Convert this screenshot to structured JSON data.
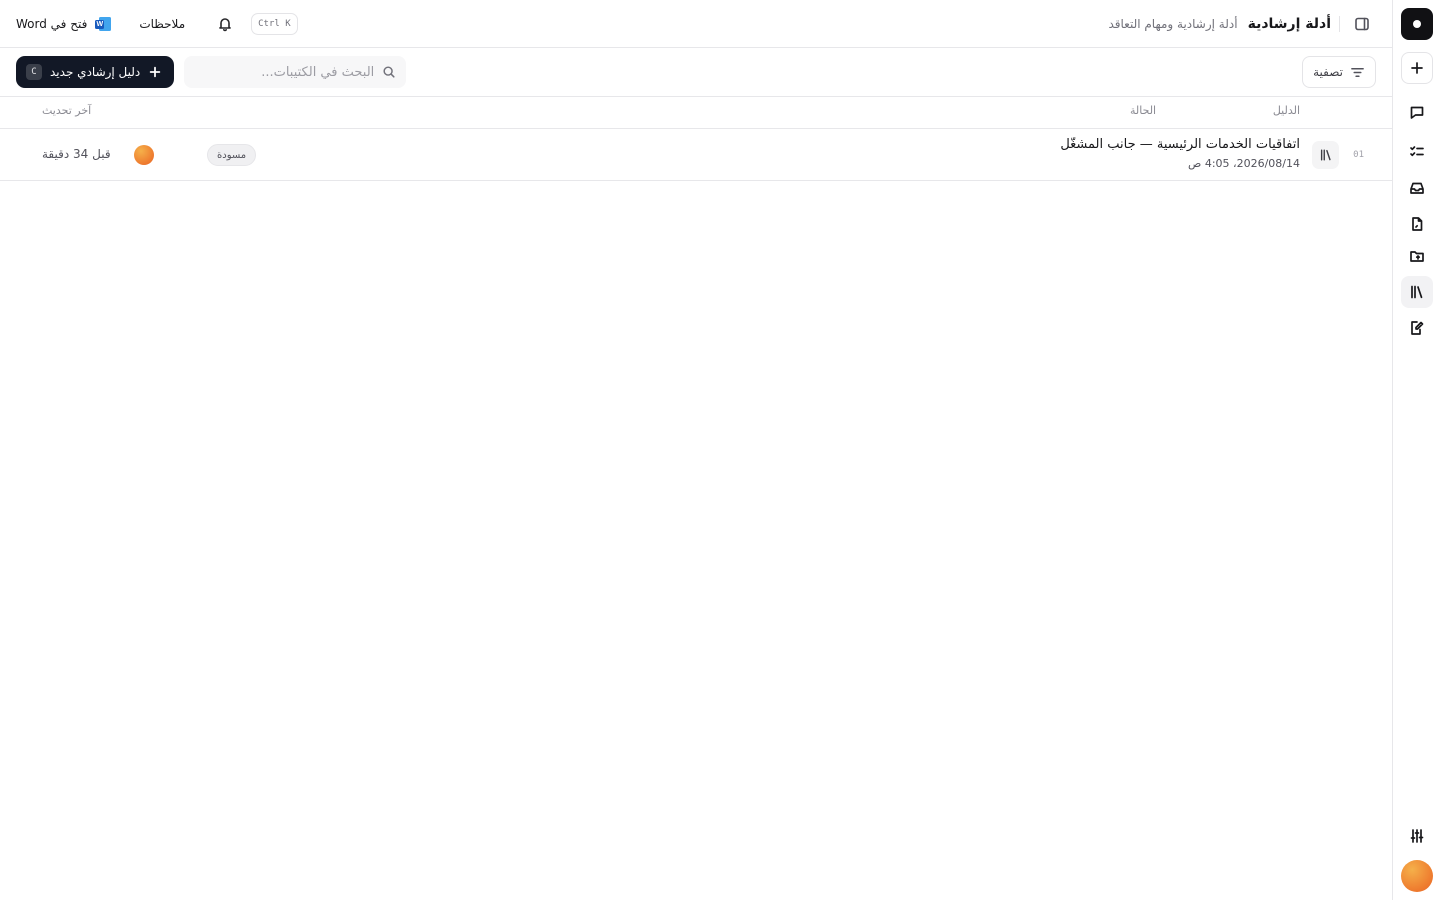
{
  "header": {
    "title": "أدلة إرشادية",
    "subtitle": "أدلة إرشادية ومهام التعاقد",
    "shortcut": "Ctrl K",
    "notes_label": "ملاحظات",
    "open_word_label": "فتح في Word",
    "word_badge": "W"
  },
  "toolbar": {
    "filter_label": "تصفية",
    "search_placeholder": "البحث في الكتيبات...",
    "search_value": "",
    "new_button_label": "دليل إرشادي جديد",
    "new_button_key": "C"
  },
  "table": {
    "columns": {
      "guide": "الدليل",
      "status": "الحالة",
      "updated": "آخر تحديث"
    },
    "rows": [
      {
        "id": "01",
        "title": "اتفاقيات الخدمات الرئيسية — جانب المشغّل",
        "date": "2026/08/14، 4:05 ص",
        "status": "مسودة",
        "updated": "قبل 34 دقيقة"
      }
    ]
  },
  "sidebar": {
    "items": [
      {
        "icon": "plus-icon"
      },
      {
        "icon": "chat-icon"
      },
      {
        "icon": "checklist-icon"
      },
      {
        "icon": "inbox-icon"
      },
      {
        "icon": "document-icon"
      },
      {
        "icon": "folder-upload-icon"
      },
      {
        "icon": "library-icon",
        "active": true
      },
      {
        "icon": "edit-document-icon"
      },
      {
        "icon": "sliders-icon"
      }
    ]
  }
}
